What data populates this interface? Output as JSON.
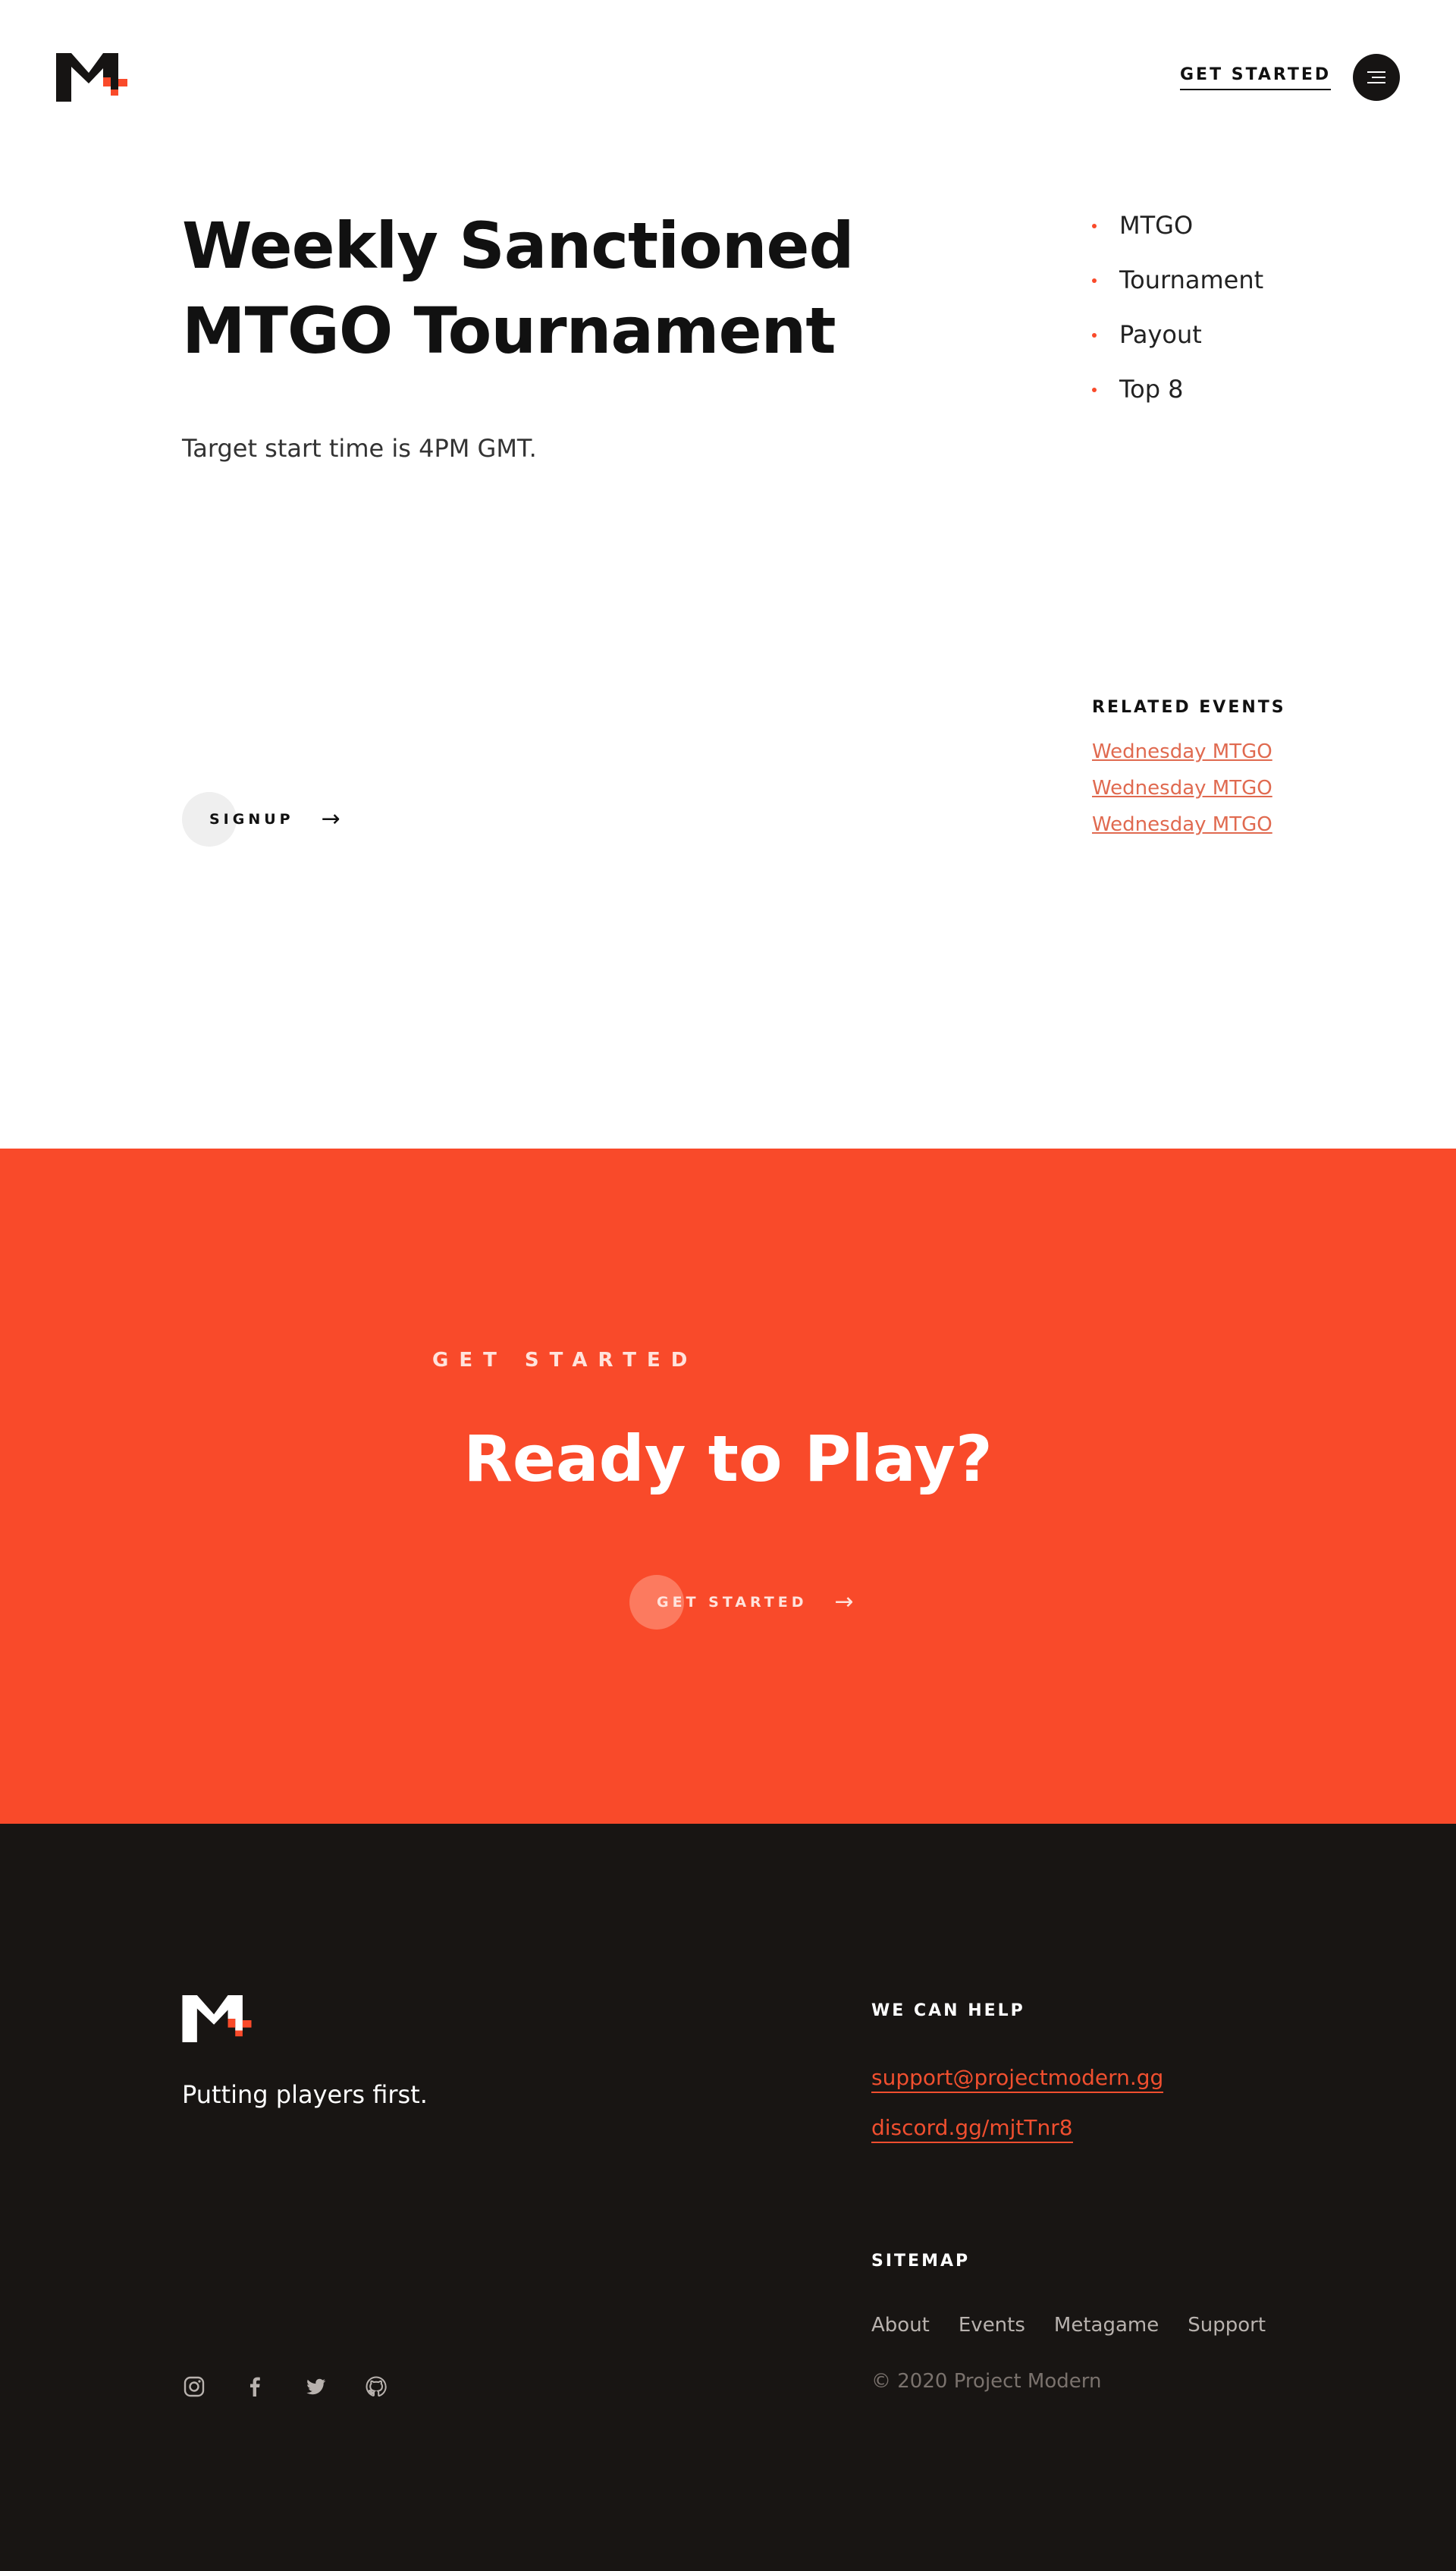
{
  "header": {
    "logo_alt": "M+",
    "cta_label": "GET STARTED"
  },
  "event": {
    "title_line1": "Weekly Sanctioned",
    "title_line2": "MTGO Tournament",
    "subtitle": "Target start time is 4PM GMT.",
    "features": [
      "MTGO",
      "Tournament",
      "Payout",
      "Top 8"
    ],
    "signup_label": "SIGNUP"
  },
  "related": {
    "heading": "RELATED EVENTS",
    "items": [
      "Wednesday MTGO",
      "Wednesday MTGO",
      "Wednesday MTGO"
    ]
  },
  "cta": {
    "eyebrow": "GET STARTED",
    "title": "Ready to Play?",
    "button_label": "GET STARTED"
  },
  "footer": {
    "tagline": "Putting players first.",
    "help_heading": "WE CAN HELP",
    "help_links": [
      "support@projectmodern.gg",
      "discord.gg/mjtTnr8"
    ],
    "sitemap_heading": "SITEMAP",
    "sitemap_links": [
      "About",
      "Events",
      "Metagame",
      "Support"
    ],
    "copyright": "© 2020 Project Modern",
    "social_icons": [
      "instagram-icon",
      "facebook-icon",
      "twitter-icon",
      "github-icon"
    ]
  },
  "colors": {
    "accent": "#f94a2a",
    "dark": "#181513",
    "link_light": "#e06a50"
  }
}
